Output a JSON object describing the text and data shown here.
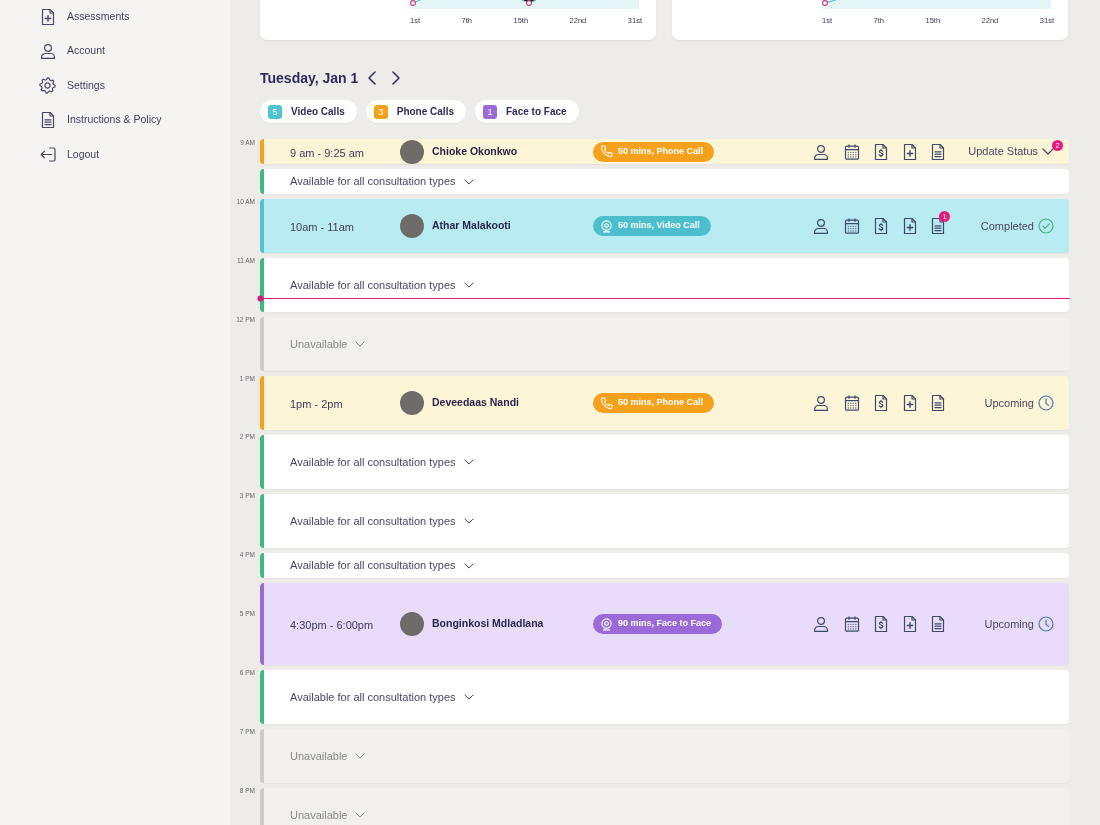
{
  "sidebar": {
    "items": [
      {
        "label": "Assessments"
      },
      {
        "label": "Account"
      },
      {
        "label": "Settings"
      },
      {
        "label": "Instructions & Policy"
      },
      {
        "label": "Logout"
      }
    ]
  },
  "summary_cards": [
    {
      "axis_labels": [
        "1st",
        "7th",
        "15th",
        "22nd",
        "31st"
      ]
    },
    {
      "axis_labels": [
        "1st",
        "7th",
        "15th",
        "22nd",
        "31st"
      ]
    }
  ],
  "schedule": {
    "date": "Tuesday, Jan 1",
    "filters": [
      {
        "count": "5",
        "label": "Video Calls",
        "color": "#4fc3d0"
      },
      {
        "count": "3",
        "label": "Phone Calls",
        "color": "#f5a11c"
      },
      {
        "count": "1",
        "label": "Face to Face",
        "color": "#9b6ad8"
      }
    ],
    "hours": [
      "9 AM",
      "10 AM",
      "11 AM",
      "12 PM",
      "1 PM",
      "2 PM",
      "3 PM",
      "4 PM",
      "5 PM",
      "6 PM",
      "7 PM",
      "8 PM"
    ],
    "slots": [
      {
        "kind": "appointment",
        "time": "9 am - 9:25 am",
        "patient": "Chioke Okonkwo",
        "call": {
          "kind": "phone",
          "label": "50 mins, Phone Call"
        },
        "status": {
          "kind": "update",
          "label": "Update Status",
          "count": "2"
        },
        "current_time": false
      },
      {
        "kind": "available",
        "label": "Available for all consultation types",
        "current_time": false
      },
      {
        "kind": "appointment",
        "time": "10am - 11am",
        "patient": "Athar Malakooti",
        "call": {
          "kind": "video",
          "label": "50 mins, Video Call"
        },
        "notes_count": "1",
        "status": {
          "kind": "completed",
          "label": "Completed"
        },
        "current_time": false
      },
      {
        "kind": "available",
        "label": "Available for all consultation types",
        "current_time": true
      },
      {
        "kind": "unavailable",
        "label": "Unavailable",
        "current_time": false
      },
      {
        "kind": "appointment",
        "time": "1pm - 2pm",
        "patient": "Deveedaas Nandi",
        "call": {
          "kind": "phone",
          "label": "50 mins, Phone Call"
        },
        "status": {
          "kind": "upcoming",
          "label": "Upcoming"
        },
        "current_time": false
      },
      {
        "kind": "available",
        "label": "Available for all consultation types",
        "current_time": false
      },
      {
        "kind": "available",
        "label": "Available for all consultation types",
        "current_time": false
      },
      {
        "kind": "available",
        "label": "Available for all consultation types",
        "current_time": false
      },
      {
        "kind": "appointment",
        "time": "4:30pm - 6:00pm",
        "patient": "Bonginkosi Mdladlana",
        "call": {
          "kind": "face",
          "label": "90 mins, Face to Face"
        },
        "status": {
          "kind": "upcoming",
          "label": "Upcoming"
        },
        "current_time": false
      },
      {
        "kind": "available",
        "label": "Available for all consultation types",
        "current_time": false
      },
      {
        "kind": "unavailable",
        "label": "Unavailable",
        "current_time": false
      },
      {
        "kind": "unavailable",
        "label": "Unavailable",
        "current_time": false
      }
    ]
  }
}
